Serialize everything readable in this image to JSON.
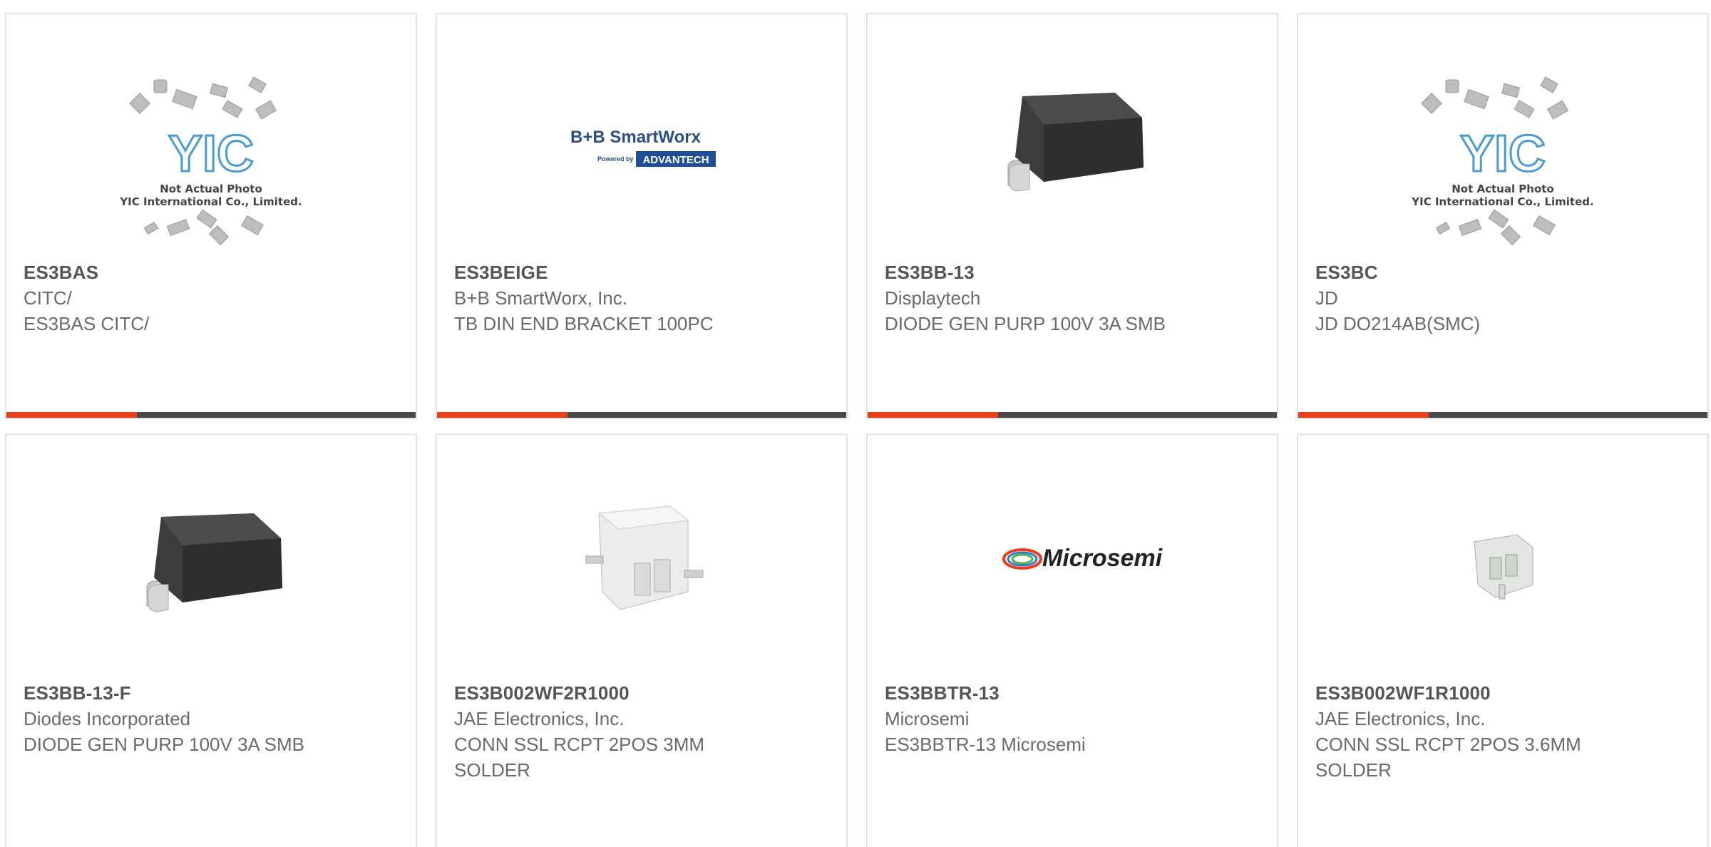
{
  "colors": {
    "accent": "#e8401c",
    "bar_dark": "#4a4a4a",
    "text": "#6a6a6a",
    "border": "#e3e3e3"
  },
  "products": [
    {
      "part": "ES3BAS",
      "manufacturer": "CITC/",
      "description": "ES3BAS CITC/",
      "image": "not-actual-photo",
      "image_text": {
        "logo": "YIC",
        "line1": "Not Actual Photo",
        "line2": "YIC International Co., Limited."
      }
    },
    {
      "part": "ES3BEIGE",
      "manufacturer": "B+B SmartWorx, Inc.",
      "description": "TB DIN END BRACKET 100PC",
      "image": "bb-smartworx-logo",
      "image_text": {
        "brand": "B+B SmartWorx",
        "powered": "Powered by",
        "partner": "ADVANTECH"
      }
    },
    {
      "part": "ES3BB-13",
      "manufacturer": "Displaytech",
      "description": "DIODE GEN PURP 100V 3A SMB",
      "image": "smb-diode-package"
    },
    {
      "part": "ES3BC",
      "manufacturer": "JD",
      "description": "JD DO214AB(SMC)",
      "image": "not-actual-photo",
      "image_text": {
        "logo": "YIC",
        "line1": "Not Actual Photo",
        "line2": "YIC International Co., Limited."
      }
    },
    {
      "part": "ES3BB-13-F",
      "manufacturer": "Diodes Incorporated",
      "description": "DIODE GEN PURP 100V 3A SMB",
      "image": "smb-diode-package"
    },
    {
      "part": "ES3B002WF2R1000",
      "manufacturer": "JAE Electronics, Inc.",
      "description": "CONN SSL RCPT 2POS 3MM SOLDER",
      "image": "connector-white"
    },
    {
      "part": "ES3BBTR-13",
      "manufacturer": "Microsemi",
      "description": "ES3BBTR-13 Microsemi",
      "image": "microsemi-logo",
      "image_text": {
        "brand": "Microsemi"
      }
    },
    {
      "part": "ES3B002WF1R1000",
      "manufacturer": "JAE Electronics, Inc.",
      "description": "CONN SSL RCPT 2POS 3.6MM SOLDER",
      "image": "connector-small"
    }
  ]
}
